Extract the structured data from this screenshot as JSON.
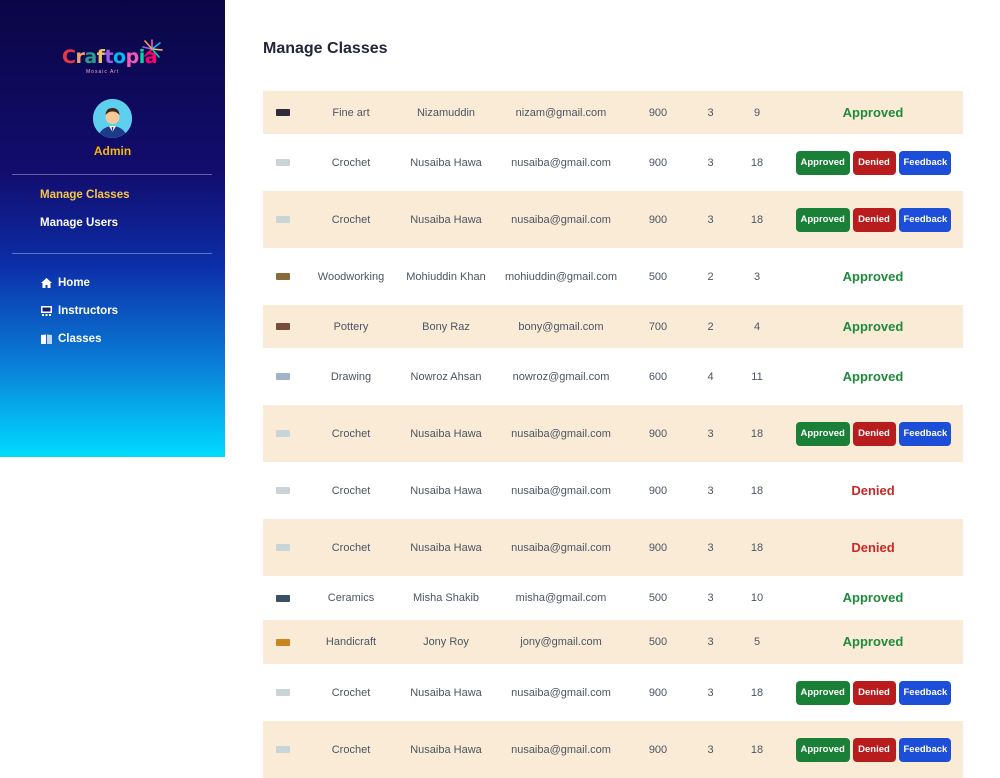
{
  "brand": {
    "logo_text": "Craftopia",
    "logo_subtitle": "Mosaic Art",
    "logo_colors": [
      "#e63946",
      "#f4a261",
      "#2a9d8f",
      "#e9c46a",
      "#9b5de5",
      "#00bbf9",
      "#f15bb5",
      "#06d6a0",
      "#ff006e"
    ]
  },
  "profile": {
    "role": "Admin",
    "avatar_icon": "user-avatar-icon"
  },
  "sidebar": {
    "dashboard_links": [
      {
        "label": "Manage Classes",
        "active": true
      },
      {
        "label": "Manage Users",
        "active": false
      }
    ],
    "site_links": [
      {
        "label": "Home",
        "icon": "home-icon"
      },
      {
        "label": "Instructors",
        "icon": "instructors-icon"
      },
      {
        "label": "Classes",
        "icon": "book-icon"
      }
    ]
  },
  "page": {
    "title": "Manage Classes"
  },
  "actions": {
    "approve_label": "Approved",
    "deny_label": "Denied",
    "feedback_label": "Feedback"
  },
  "colors": {
    "approved": "#1f8a3b",
    "denied": "#c62828",
    "row_alt": "#faebd7",
    "approve_btn": "#1a7f37",
    "deny_btn": "#b91c1c",
    "feedback_btn": "#1d4ed8"
  },
  "classes": [
    {
      "thumb": "#2d2d3a",
      "name": "Fine art",
      "instructor": "Nizamuddin",
      "email": "nizam@gmail.com",
      "price": "900",
      "seats": "3",
      "enrolled": "9",
      "status": "Approved",
      "state": "approved"
    },
    {
      "thumb": "#c9d4d8",
      "name": "Crochet",
      "instructor": "Nusaiba Hawa",
      "email": "nusaiba@gmail.com",
      "price": "900",
      "seats": "3",
      "enrolled": "18",
      "status": "",
      "state": "pending"
    },
    {
      "thumb": "#c9d4d8",
      "name": "Crochet",
      "instructor": "Nusaiba Hawa",
      "email": "nusaiba@gmail.com",
      "price": "900",
      "seats": "3",
      "enrolled": "18",
      "status": "",
      "state": "pending"
    },
    {
      "thumb": "#8a6a3a",
      "name": "Woodworking",
      "instructor": "Mohiuddin Khan",
      "email": "mohiuddin@gmail.com",
      "price": "500",
      "seats": "2",
      "enrolled": "3",
      "status": "Approved",
      "state": "approved"
    },
    {
      "thumb": "#7a4a3a",
      "name": "Pottery",
      "instructor": "Bony Raz",
      "email": "bony@gmail.com",
      "price": "700",
      "seats": "2",
      "enrolled": "4",
      "status": "Approved",
      "state": "approved"
    },
    {
      "thumb": "#9fb4c8",
      "name": "Drawing",
      "instructor": "Nowroz Ahsan",
      "email": "nowroz@gmail.com",
      "price": "600",
      "seats": "4",
      "enrolled": "11",
      "status": "Approved",
      "state": "approved"
    },
    {
      "thumb": "#c9d4d8",
      "name": "Crochet",
      "instructor": "Nusaiba Hawa",
      "email": "nusaiba@gmail.com",
      "price": "900",
      "seats": "3",
      "enrolled": "18",
      "status": "",
      "state": "pending"
    },
    {
      "thumb": "#c9d4d8",
      "name": "Crochet",
      "instructor": "Nusaiba Hawa",
      "email": "nusaiba@gmail.com",
      "price": "900",
      "seats": "3",
      "enrolled": "18",
      "status": "Denied",
      "state": "denied"
    },
    {
      "thumb": "#c9d4d8",
      "name": "Crochet",
      "instructor": "Nusaiba Hawa",
      "email": "nusaiba@gmail.com",
      "price": "900",
      "seats": "3",
      "enrolled": "18",
      "status": "Denied",
      "state": "denied"
    },
    {
      "thumb": "#3a5068",
      "name": "Ceramics",
      "instructor": "Misha Shakib",
      "email": "misha@gmail.com",
      "price": "500",
      "seats": "3",
      "enrolled": "10",
      "status": "Approved",
      "state": "approved"
    },
    {
      "thumb": "#c8861e",
      "name": "Handicraft",
      "instructor": "Jony Roy",
      "email": "jony@gmail.com",
      "price": "500",
      "seats": "3",
      "enrolled": "5",
      "status": "Approved",
      "state": "approved"
    },
    {
      "thumb": "#c9d4d8",
      "name": "Crochet",
      "instructor": "Nusaiba Hawa",
      "email": "nusaiba@gmail.com",
      "price": "900",
      "seats": "3",
      "enrolled": "18",
      "status": "",
      "state": "pending"
    },
    {
      "thumb": "#c9d4d8",
      "name": "Crochet",
      "instructor": "Nusaiba Hawa",
      "email": "nusaiba@gmail.com",
      "price": "900",
      "seats": "3",
      "enrolled": "18",
      "status": "",
      "state": "pending"
    }
  ]
}
